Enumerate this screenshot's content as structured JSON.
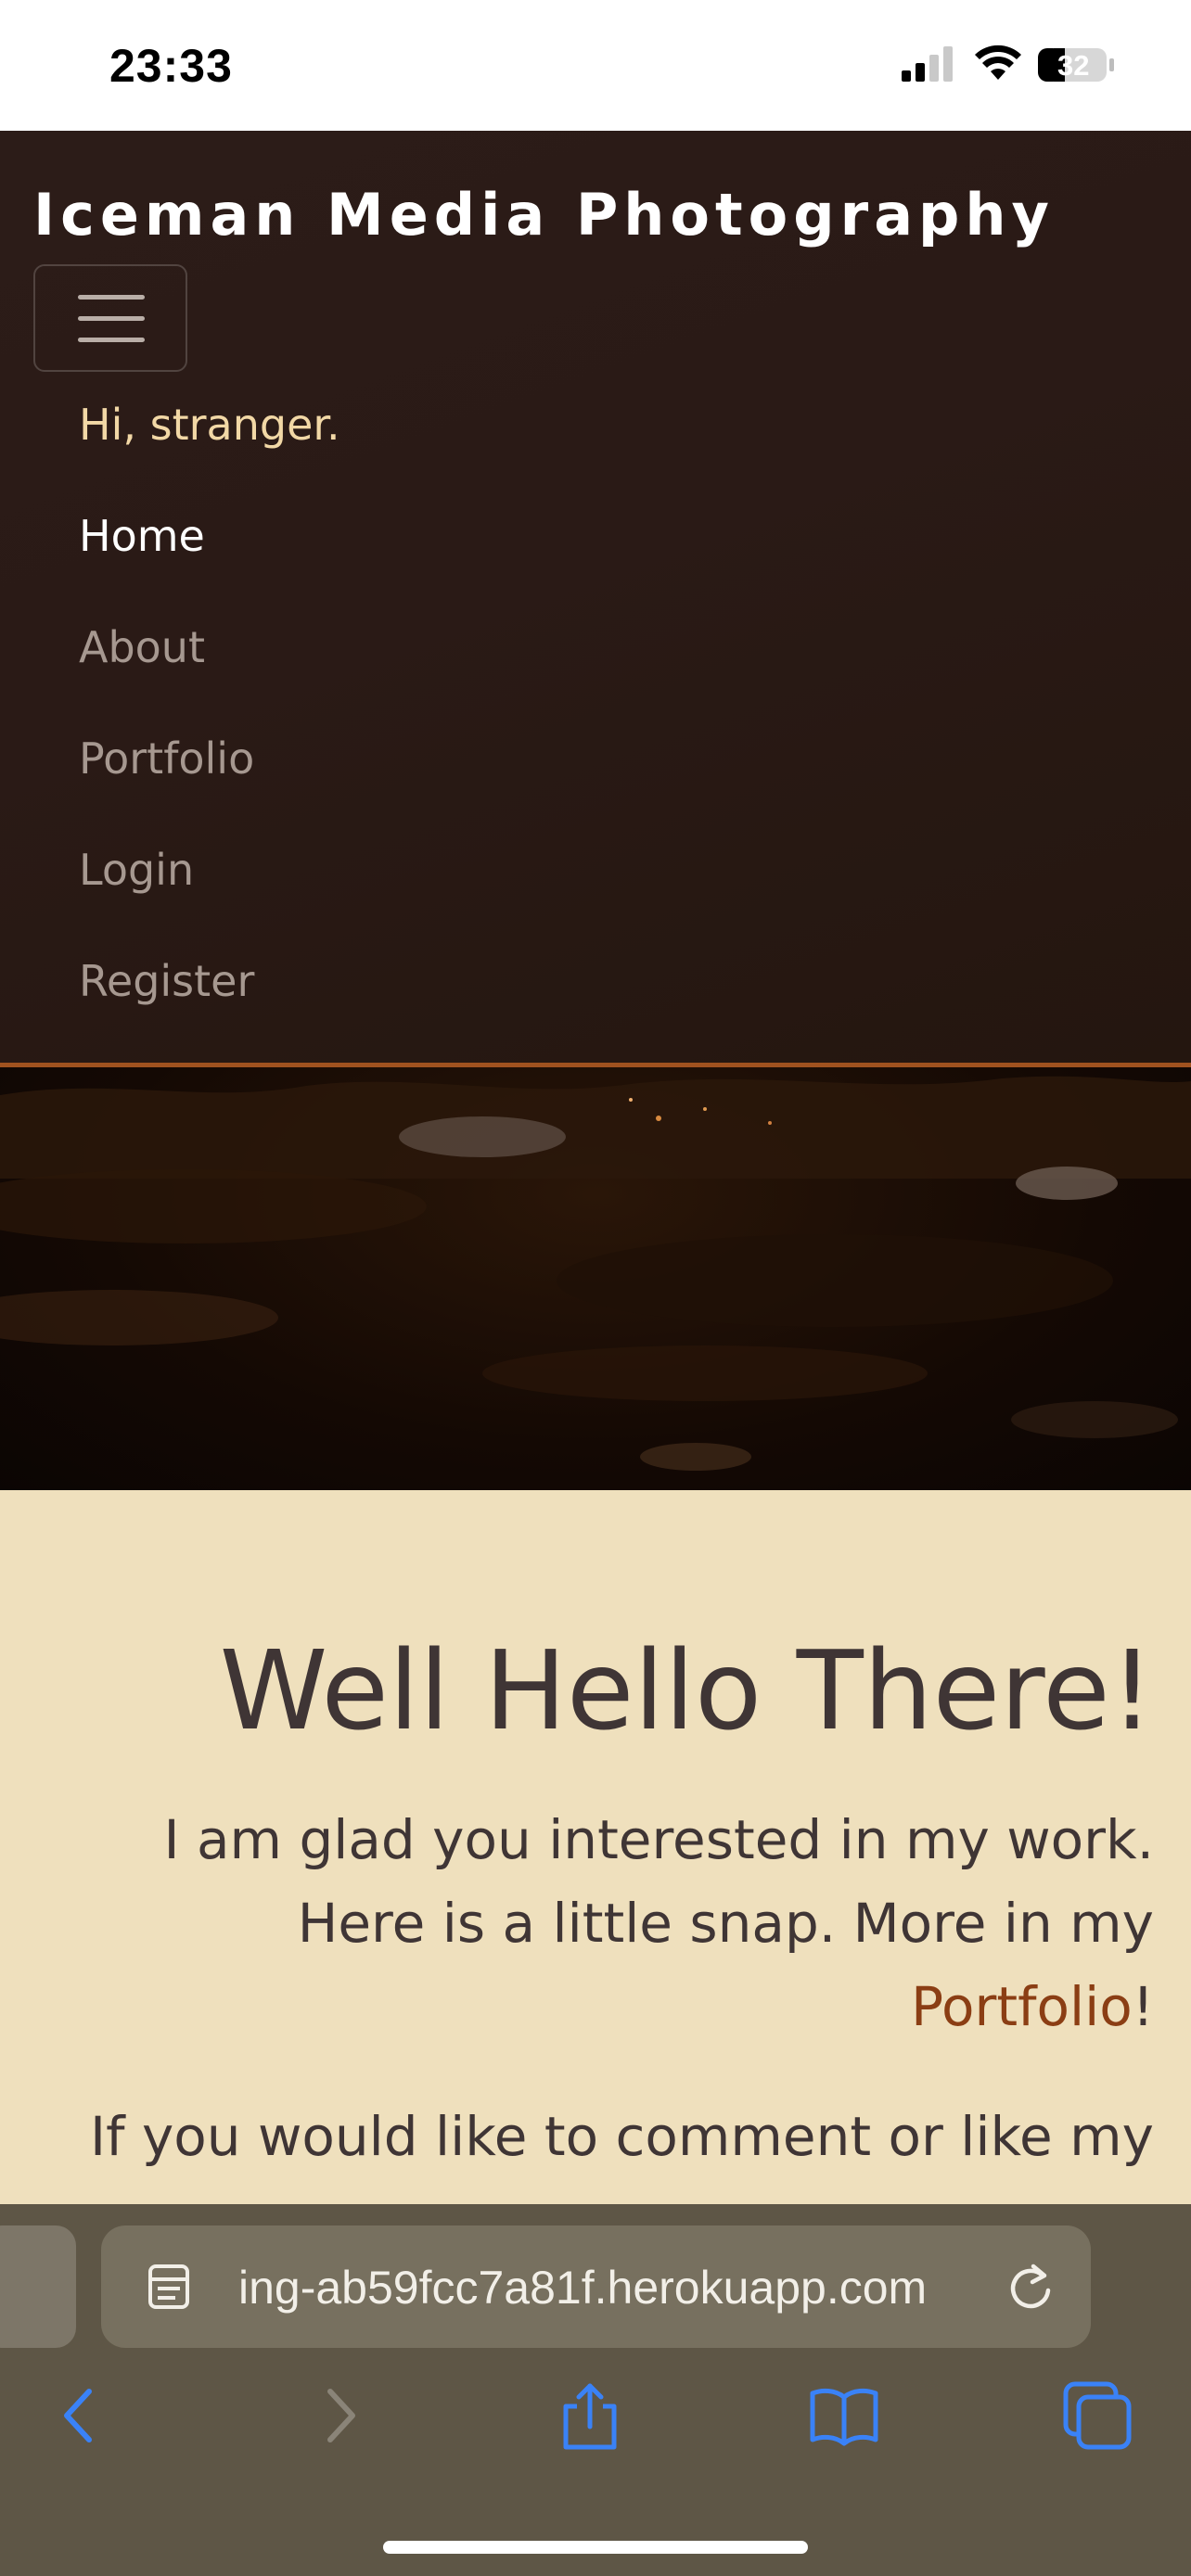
{
  "status_bar": {
    "time": "23:33",
    "battery": "32",
    "icons": [
      "signal-icon",
      "wifi-icon",
      "battery-icon"
    ]
  },
  "header": {
    "brand": "Iceman Media Photography",
    "menu_icon": "hamburger-icon"
  },
  "nav": {
    "greeting": "Hi, stranger.",
    "items": [
      {
        "label": "Home",
        "active": true
      },
      {
        "label": "About",
        "active": false
      },
      {
        "label": "Portfolio",
        "active": false
      },
      {
        "label": "Login",
        "active": false
      },
      {
        "label": "Register",
        "active": false
      }
    ]
  },
  "main": {
    "title": "Well Hello There!",
    "intro_line1": "I am glad you interested in my work.",
    "intro_line2": "Here is a little snap. More in my",
    "intro_link": "Portfolio",
    "intro_end": "!",
    "comment_line": "If you would like to comment or like my"
  },
  "browser": {
    "url": "ing-ab59fcc7a81f.herokuapp.com",
    "toolbar_icons": [
      "back-icon",
      "forward-icon",
      "share-icon",
      "bookmarks-icon",
      "tabs-icon"
    ]
  },
  "colors": {
    "nav_bg": "#2a1a16",
    "nav_border": "#a0521f",
    "content_bg": "#efe0bd",
    "text": "#3f3535",
    "link": "#8b3e14",
    "browser_bg": "#5e5646",
    "accent_blue": "#3a82f7"
  }
}
